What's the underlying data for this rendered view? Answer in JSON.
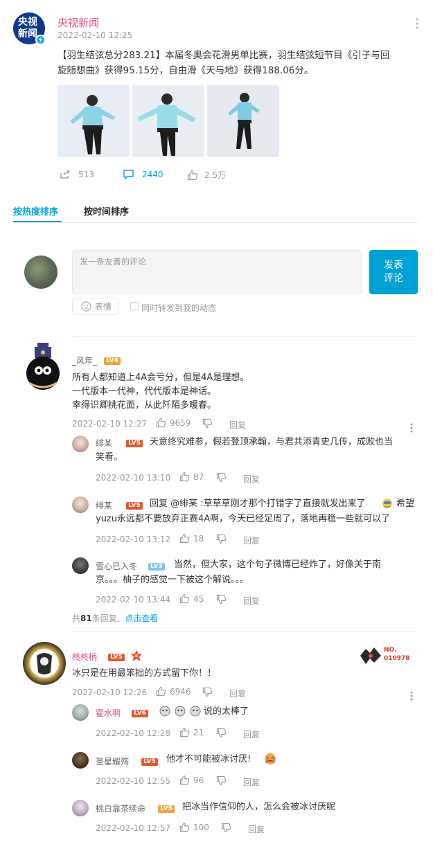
{
  "post": {
    "author": "央视新闻",
    "logo_text_top": "央视",
    "logo_text_bottom": "新闻",
    "time": "2022-02-10 12:25",
    "text_line1": "【羽生结弦总分283.21】本届冬奥会花滑男单比赛，羽生结弦短节目《引子与回",
    "text_line2": "旋随想曲》获得95.15分，自由滑《天与地》获得188.06分。",
    "repost_count": "513",
    "comment_count": "2440",
    "like_count": "2.5万"
  },
  "tabs": [
    {
      "label": "按热度排序",
      "active": true
    },
    {
      "label": "按时间排序",
      "active": false
    }
  ],
  "composer": {
    "placeholder": "发一条友善的评论",
    "emoji_label": "表情",
    "repost_label": "同时转发到我的动态",
    "submit_label_line1": "发表",
    "submit_label_line2": "评论"
  },
  "comments": [
    {
      "user": "_风年_",
      "level": "LV4",
      "lines": [
        "所有人都知道上4A会亏分，但是4A是理想。",
        "一代版本一代神，代代版本是神话。",
        "幸得识卿桃花面，从此阡陌多暖春。"
      ],
      "time": "2022-02-10 12:27",
      "likes": "9659",
      "reply_label": "回复",
      "replies": [
        {
          "user": "绯某",
          "level": "LV5",
          "line1": "天意终究难参，假若登顶承翰，与君共添青史几传，成败也当",
          "line2": "笑看。",
          "time": "2022-02-10 13:10",
          "likes": "87",
          "reply_label": "回复"
        },
        {
          "user": "绯某",
          "level": "LV5",
          "line1": "回复 @绯某 :草草草刚才那个打错字了直接就发出来了",
          "line1b": "希望",
          "line2": "yuzu永远都不要放弃正赛4A啊，今天已经足周了，落地再稳一些就可以了",
          "time": "2022-02-10 13:12",
          "likes": "18",
          "reply_label": "回复"
        },
        {
          "user": "雪心已入冬",
          "level": "LV3",
          "line1": "当然，但大家，这个句子微博已经炸了，好像关于南",
          "line2": "京。。。柚子的感觉一下被这个解说。。。",
          "time": "2022-02-10 13:44",
          "likes": "45",
          "reply_label": "回复"
        }
      ],
      "more_prefix": "共",
      "more_count": "81",
      "more_suffix": "条回复,",
      "more_link": "点击查看"
    },
    {
      "user": "柊柊柄",
      "level": "LV5",
      "badge_no_label": "NO.",
      "badge_no": "010978",
      "lines": [
        "冰只是在用最笨拙的方式留下你！！"
      ],
      "time": "2022-02-10 12:26",
      "likes": "6946",
      "reply_label": "回复",
      "replies": [
        {
          "user": "霍水啊",
          "level": "LV6",
          "line1": "说的太棒了",
          "time": "2022-02-10 12:28",
          "likes": "21",
          "reply_label": "回复"
        },
        {
          "user": "圣星耀殇",
          "level": "LV5",
          "line1": "他才不可能被冰讨厌!",
          "time": "2022-02-10 12:55",
          "likes": "96",
          "reply_label": "回复"
        },
        {
          "user": "桃白靠茶续命",
          "level": "LV5",
          "line1": "把冰当作信仰的人，怎么会被冰讨厌呢",
          "time": "2022-02-10 12:57",
          "likes": "100",
          "reply_label": "回复"
        }
      ]
    }
  ],
  "colors": {
    "accent": "#00a1d6",
    "pink": "#e0528a",
    "muted": "#999999"
  }
}
